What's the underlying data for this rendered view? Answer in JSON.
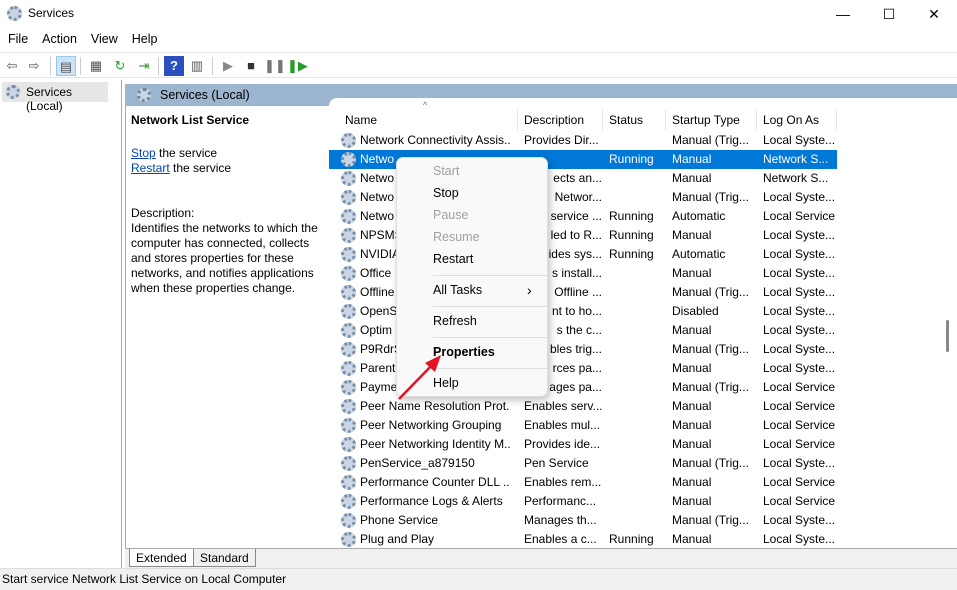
{
  "window": {
    "title": "Services",
    "minimize": "—",
    "maximize": "☐",
    "close": "✕"
  },
  "menubar": [
    "File",
    "Action",
    "View",
    "Help"
  ],
  "toolbar": [
    "back-icon",
    "forward-icon",
    "show-hide-tree-icon",
    "properties-icon",
    "refresh-icon",
    "export-icon",
    "help-icon",
    "console-icon",
    "start-icon",
    "stop-icon",
    "pause-icon",
    "restart-icon"
  ],
  "tree": {
    "item": "Services (Local)"
  },
  "band": {
    "title": "Services (Local)"
  },
  "detail": {
    "service_name": "Network List Service",
    "stop_link": "Stop",
    "stop_rest": " the service",
    "restart_link": "Restart",
    "restart_rest": " the service",
    "desc_label": "Description:",
    "desc_text": "Identifies the networks to which the computer has connected, collects and stores properties for these networks, and notifies applications when these properties change."
  },
  "columns": [
    "Name",
    "Description",
    "Status",
    "Startup Type",
    "Log On As"
  ],
  "rows": [
    [
      "Network Connectivity Assis...",
      "Provides Dir...",
      "",
      "Manual (Trig...",
      "Local Syste..."
    ],
    [
      "Netwo",
      "",
      "Running",
      "Manual",
      "Network S..."
    ],
    [
      "Netwo",
      "ects an...",
      "",
      "Manual",
      "Network S..."
    ],
    [
      "Netwo",
      "Networ...",
      "",
      "Manual (Trig...",
      "Local Syste..."
    ],
    [
      "Netwo",
      "service ...",
      "Running",
      "Automatic",
      "Local Service"
    ],
    [
      "NPSMS",
      "led to R...",
      "Running",
      "Manual",
      "Local Syste..."
    ],
    [
      "NVIDIA",
      "ides sys...",
      "Running",
      "Automatic",
      "Local Syste..."
    ],
    [
      "Office",
      "s install...",
      "",
      "Manual",
      "Local Syste..."
    ],
    [
      "Offline",
      "Offline ...",
      "",
      "Manual (Trig...",
      "Local Syste..."
    ],
    [
      "OpenS",
      "nt to ho...",
      "",
      "Disabled",
      "Local Syste..."
    ],
    [
      "Optim",
      "s the c...",
      "",
      "Manual",
      "Local Syste..."
    ],
    [
      "P9RdrS",
      "bles trig...",
      "",
      "Manual (Trig...",
      "Local Syste..."
    ],
    [
      "Parent",
      "rces pa...",
      "",
      "Manual",
      "Local Syste..."
    ],
    [
      "Payme",
      "ages pa...",
      "",
      "Manual (Trig...",
      "Local Service"
    ],
    [
      "Peer Name Resolution Prot...",
      "Enables serv...",
      "",
      "Manual",
      "Local Service"
    ],
    [
      "Peer Networking Grouping",
      "Enables mul...",
      "",
      "Manual",
      "Local Service"
    ],
    [
      "Peer Networking Identity M...",
      "Provides ide...",
      "",
      "Manual",
      "Local Service"
    ],
    [
      "PenService_a879150",
      "Pen Service",
      "",
      "Manual (Trig...",
      "Local Syste..."
    ],
    [
      "Performance Counter DLL ...",
      "Enables rem...",
      "",
      "Manual",
      "Local Service"
    ],
    [
      "Performance Logs & Alerts",
      "Performanc...",
      "",
      "Manual",
      "Local Service"
    ],
    [
      "Phone Service",
      "Manages th...",
      "",
      "Manual (Trig...",
      "Local Syste..."
    ],
    [
      "Plug and Play",
      "Enables a c...",
      "Running",
      "Manual",
      "Local Syste..."
    ]
  ],
  "context_menu": [
    {
      "label": "Start",
      "disabled": true
    },
    {
      "label": "Stop"
    },
    {
      "label": "Pause",
      "disabled": true
    },
    {
      "label": "Resume",
      "disabled": true
    },
    {
      "label": "Restart"
    },
    {
      "label": "All Tasks",
      "submenu": "›"
    },
    {
      "label": "Refresh"
    },
    {
      "label": "Properties",
      "bold": true
    },
    {
      "label": "Help"
    }
  ],
  "tabs": [
    "Extended",
    "Standard"
  ],
  "status": "Start service Network List Service on Local Computer",
  "colors": {
    "selection": "#0078d7",
    "band": "#9db6d0",
    "arrow": "#e81123"
  }
}
